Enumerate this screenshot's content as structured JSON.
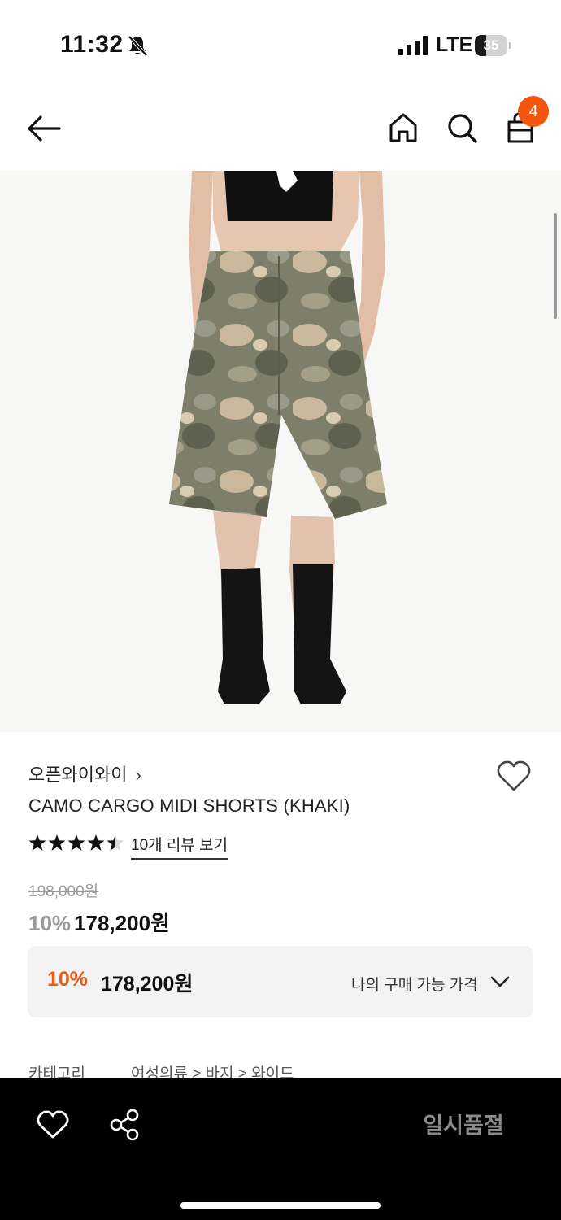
{
  "status_bar": {
    "time": "11:32",
    "network": "LTE",
    "battery_level": "35"
  },
  "header": {
    "cart_count": "4"
  },
  "product": {
    "brand": "오픈와이와이",
    "brand_chevron": "›",
    "name": "CAMO CARGO MIDI SHORTS (KHAKI)",
    "rating": 4.5,
    "review_link": "10개 리뷰 보기",
    "original_price": "198,000원",
    "discount_percent": "10%",
    "sale_price": "178,200원"
  },
  "benefit": {
    "discount_percent": "10%",
    "price": "178,200원",
    "label": "나의 구매 가능 가격"
  },
  "category": {
    "label": "카테고리",
    "path": "여성의류 > 바지 > 와이드"
  },
  "bottom_bar": {
    "action_label": "일시품절"
  },
  "colors": {
    "accent": "#f4550e",
    "discount_orange": "#ec5a16",
    "bottom_bar": "#000000"
  },
  "icons": [
    "back-arrow-icon",
    "home-icon",
    "search-icon",
    "cart-icon",
    "heart-icon",
    "share-icon",
    "chevron-down-icon",
    "star-icon",
    "bell-muted-icon"
  ]
}
